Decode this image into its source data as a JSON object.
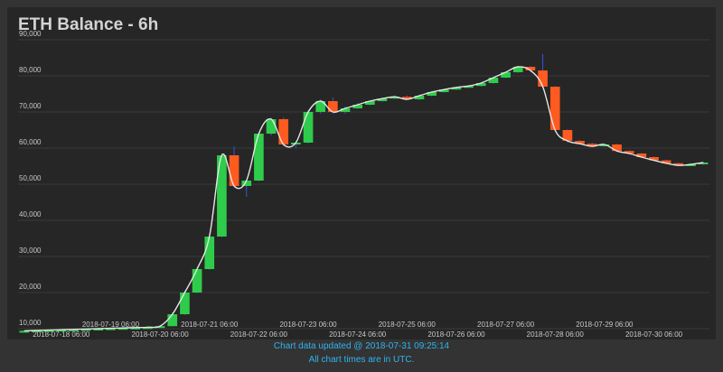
{
  "chart_data": {
    "type": "candlestick",
    "title": "ETH Balance - 6h",
    "xlabel": "",
    "ylabel": "",
    "ylim": [
      8000,
      90000
    ],
    "y_ticks": [
      10000,
      20000,
      30000,
      40000,
      50000,
      60000,
      70000,
      80000,
      90000
    ],
    "y_tick_labels": [
      "10,000",
      "20,000",
      "30,000",
      "40,000",
      "50,000",
      "60,000",
      "70,000",
      "80,000",
      "90,000"
    ],
    "x_ticks": [
      {
        "label": "2018-07-18 06:00",
        "t": 3
      },
      {
        "label": "2018-07-19 06:00",
        "t": 7
      },
      {
        "label": "2018-07-20 06:00",
        "t": 11
      },
      {
        "label": "2018-07-21 06:00",
        "t": 15
      },
      {
        "label": "2018-07-22 06:00",
        "t": 19
      },
      {
        "label": "2018-07-23 06:00",
        "t": 23
      },
      {
        "label": "2018-07-24 06:00",
        "t": 27
      },
      {
        "label": "2018-07-25 06:00",
        "t": 31
      },
      {
        "label": "2018-07-26 06:00",
        "t": 35
      },
      {
        "label": "2018-07-27 06:00",
        "t": 39
      },
      {
        "label": "2018-07-28 06:00",
        "t": 43
      },
      {
        "label": "2018-07-29 06:00",
        "t": 47
      },
      {
        "label": "2018-07-30 06:00",
        "t": 51
      }
    ],
    "x_range": [
      -0.5,
      55.5
    ],
    "grid": true,
    "legend": "none",
    "colors": {
      "up": "#2ecc4a",
      "down": "#ff5a1f",
      "wick": "#3355dd",
      "line": "#e6e6e6"
    },
    "candles": [
      {
        "t": 0,
        "open": 9300,
        "high": 9500,
        "low": 9200,
        "close": 9400
      },
      {
        "t": 1,
        "open": 9400,
        "high": 9600,
        "low": 9300,
        "close": 9500
      },
      {
        "t": 2,
        "open": 9500,
        "high": 9700,
        "low": 9400,
        "close": 9600
      },
      {
        "t": 3,
        "open": 9600,
        "high": 9800,
        "low": 9500,
        "close": 9700
      },
      {
        "t": 4,
        "open": 9700,
        "high": 9900,
        "low": 9600,
        "close": 9800
      },
      {
        "t": 5,
        "open": 9800,
        "high": 9900,
        "low": 9700,
        "close": 9900
      },
      {
        "t": 6,
        "open": 9900,
        "high": 10000,
        "low": 9800,
        "close": 10000
      },
      {
        "t": 7,
        "open": 10000,
        "high": 10100,
        "low": 9900,
        "close": 10100
      },
      {
        "t": 8,
        "open": 10100,
        "high": 10200,
        "low": 10000,
        "close": 10200
      },
      {
        "t": 9,
        "open": 10200,
        "high": 10300,
        "low": 10100,
        "close": 10300
      },
      {
        "t": 10,
        "open": 10300,
        "high": 10500,
        "low": 10200,
        "close": 10400
      },
      {
        "t": 11,
        "open": 10400,
        "high": 10800,
        "low": 10300,
        "close": 10700
      },
      {
        "t": 12,
        "open": 10700,
        "high": 14500,
        "low": 10600,
        "close": 14000
      },
      {
        "t": 13,
        "open": 14000,
        "high": 20500,
        "low": 13800,
        "close": 20000
      },
      {
        "t": 14,
        "open": 20000,
        "high": 27000,
        "low": 19800,
        "close": 26500
      },
      {
        "t": 15,
        "open": 26500,
        "high": 36000,
        "low": 26300,
        "close": 35500
      },
      {
        "t": 16,
        "open": 35500,
        "high": 58500,
        "low": 35300,
        "close": 58000
      },
      {
        "t": 17,
        "open": 58000,
        "high": 60500,
        "low": 49000,
        "close": 49500
      },
      {
        "t": 18,
        "open": 49500,
        "high": 51000,
        "low": 46500,
        "close": 51000
      },
      {
        "t": 19,
        "open": 51000,
        "high": 64500,
        "low": 50800,
        "close": 64000
      },
      {
        "t": 20,
        "open": 64000,
        "high": 68500,
        "low": 63500,
        "close": 68000
      },
      {
        "t": 21,
        "open": 68000,
        "high": 68500,
        "low": 60500,
        "close": 61000
      },
      {
        "t": 22,
        "open": 61000,
        "high": 62000,
        "low": 60000,
        "close": 61500
      },
      {
        "t": 23,
        "open": 61500,
        "high": 70500,
        "low": 61300,
        "close": 70000
      },
      {
        "t": 24,
        "open": 70000,
        "high": 73500,
        "low": 69500,
        "close": 73000
      },
      {
        "t": 25,
        "open": 73000,
        "high": 74000,
        "low": 69500,
        "close": 70000
      },
      {
        "t": 26,
        "open": 70000,
        "high": 71500,
        "low": 69500,
        "close": 71000
      },
      {
        "t": 27,
        "open": 71000,
        "high": 72500,
        "low": 70800,
        "close": 72000
      },
      {
        "t": 28,
        "open": 72000,
        "high": 73300,
        "low": 71800,
        "close": 73000
      },
      {
        "t": 29,
        "open": 73000,
        "high": 74000,
        "low": 72800,
        "close": 73700
      },
      {
        "t": 30,
        "open": 73700,
        "high": 74500,
        "low": 73500,
        "close": 74200
      },
      {
        "t": 31,
        "open": 74200,
        "high": 74600,
        "low": 73400,
        "close": 73500
      },
      {
        "t": 32,
        "open": 73500,
        "high": 74800,
        "low": 73300,
        "close": 74500
      },
      {
        "t": 33,
        "open": 74500,
        "high": 75700,
        "low": 74300,
        "close": 75500
      },
      {
        "t": 34,
        "open": 75500,
        "high": 76400,
        "low": 75300,
        "close": 76200
      },
      {
        "t": 35,
        "open": 76200,
        "high": 77000,
        "low": 76000,
        "close": 76800
      },
      {
        "t": 36,
        "open": 76800,
        "high": 77400,
        "low": 76600,
        "close": 77200
      },
      {
        "t": 37,
        "open": 77200,
        "high": 78200,
        "low": 77000,
        "close": 78000
      },
      {
        "t": 38,
        "open": 78000,
        "high": 79700,
        "low": 77800,
        "close": 79500
      },
      {
        "t": 39,
        "open": 79500,
        "high": 81200,
        "low": 79300,
        "close": 81000
      },
      {
        "t": 40,
        "open": 81000,
        "high": 82700,
        "low": 80800,
        "close": 82500
      },
      {
        "t": 41,
        "open": 82500,
        "high": 82700,
        "low": 81000,
        "close": 81500
      },
      {
        "t": 42,
        "open": 81500,
        "high": 86000,
        "low": 76500,
        "close": 77000
      },
      {
        "t": 43,
        "open": 77000,
        "high": 77200,
        "low": 64500,
        "close": 65000
      },
      {
        "t": 44,
        "open": 65000,
        "high": 65200,
        "low": 61500,
        "close": 62000
      },
      {
        "t": 45,
        "open": 62000,
        "high": 62200,
        "low": 61000,
        "close": 61200
      },
      {
        "t": 46,
        "open": 61200,
        "high": 61400,
        "low": 60300,
        "close": 60500
      },
      {
        "t": 47,
        "open": 60500,
        "high": 61200,
        "low": 60300,
        "close": 61000
      },
      {
        "t": 48,
        "open": 61000,
        "high": 61200,
        "low": 59000,
        "close": 59200
      },
      {
        "t": 49,
        "open": 59200,
        "high": 59400,
        "low": 58200,
        "close": 58500
      },
      {
        "t": 50,
        "open": 58500,
        "high": 58700,
        "low": 57300,
        "close": 57500
      },
      {
        "t": 51,
        "open": 57500,
        "high": 57700,
        "low": 56400,
        "close": 56600
      },
      {
        "t": 52,
        "open": 56600,
        "high": 56800,
        "low": 55600,
        "close": 55800
      },
      {
        "t": 53,
        "open": 55800,
        "high": 56000,
        "low": 55000,
        "close": 55200
      },
      {
        "t": 54,
        "open": 55200,
        "high": 55700,
        "low": 55000,
        "close": 55500
      },
      {
        "t": 55,
        "open": 55500,
        "high": 56200,
        "low": 55300,
        "close": 56000
      }
    ]
  },
  "footer": {
    "updated": "Chart data updated @ 2018-07-31 09:25:14",
    "timezone_note": "All chart times are in UTC."
  }
}
